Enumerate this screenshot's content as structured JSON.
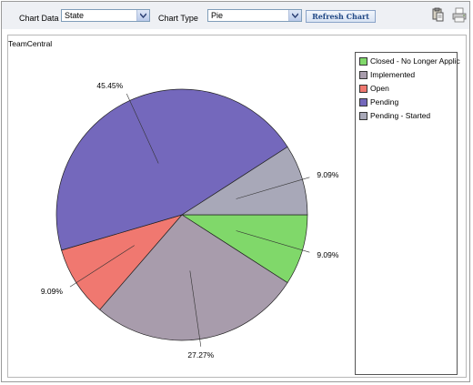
{
  "toolbar": {
    "chart_data_label": "Chart Data",
    "chart_data_value": "State",
    "chart_type_label": "Chart Type",
    "chart_type_value": "Pie",
    "refresh_label": "Refresh Chart",
    "icons": [
      "clipboard-icon",
      "printer-icon"
    ]
  },
  "chart_data": {
    "type": "pie",
    "title": "TeamCentral",
    "categories": [
      "Closed - No Longer Applic",
      "Implemented",
      "Open",
      "Pending",
      "Pending - Started"
    ],
    "values": [
      9.09,
      27.27,
      9.09,
      45.45,
      9.09
    ],
    "colors": [
      "#80d86a",
      "#a89cac",
      "#f07870",
      "#7468bc",
      "#a8a8b8"
    ],
    "slice_order": [
      "Closed - No Longer Applic",
      "Implemented",
      "Open",
      "Pending",
      "Pending - Started"
    ],
    "data_labels": [
      "9.09%",
      "27.27%",
      "9.09%",
      "45.45%",
      "9.09%"
    ],
    "legend_position": "right",
    "legend_labels": [
      "Closed - No Longer Applic",
      "Implemented",
      "Open",
      "Pending",
      "Pending - Started"
    ]
  }
}
